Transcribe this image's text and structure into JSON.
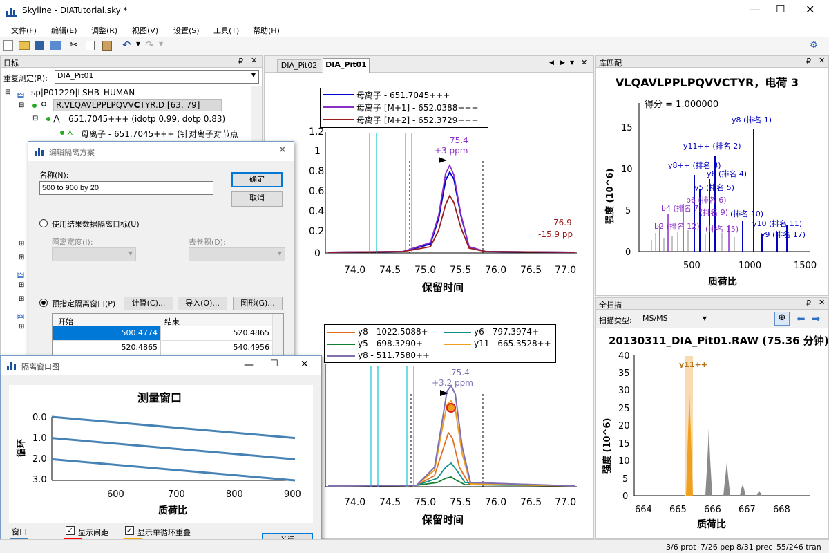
{
  "window": {
    "title": "Skyline - DIATutorial.sky *"
  },
  "menu": [
    "文件(F)",
    "编辑(E)",
    "调整(R)",
    "视图(V)",
    "设置(S)",
    "工具(T)",
    "帮助(H)"
  ],
  "targets": {
    "header": "目标",
    "replicate_label": "重复测定(R):",
    "replicate_value": "DIA_Pit01",
    "protein": "sp|P01229|LSHB_HUMAN",
    "peptide_pre": "R.VLQAVLPPLPQVV",
    "peptide_bold": "C",
    "peptide_post": "TYR.D [63, 79]",
    "precursor": "651.7045+++ (idotp 0.99, dotp 0.83)",
    "transition": "母离子 - 651.7045+++ (针对离子对节点"
  },
  "chrom": {
    "tabs": [
      "DIA_Pit02",
      "DIA_Pit01"
    ],
    "top": {
      "legend": [
        {
          "label": "母离子 - 651.7045+++",
          "color": "#0000d0"
        },
        {
          "label": "母离子 [M+1] - 652.0388+++",
          "color": "#8b2fc9"
        },
        {
          "label": "母离子 [M+2] - 652.3729+++",
          "color": "#9b1c1c"
        }
      ],
      "peak_rt": "75.4",
      "peak_ppm": "+3 ppm",
      "side_rt": "76.9",
      "side_ppm": "-15.9 pp",
      "yticks": [
        "1.2",
        "1",
        "0.8",
        "0.6",
        "0.4",
        "0.2",
        "0"
      ]
    },
    "bottom": {
      "legend": [
        {
          "label": "y8 - 1022.5088+",
          "color": "#e07020"
        },
        {
          "label": "y6 - 797.3974+",
          "color": "#10908a"
        },
        {
          "label": "y5 - 698.3290+",
          "color": "#108030"
        },
        {
          "label": "y11 - 665.3528++",
          "color": "#f0a020"
        },
        {
          "label": "y8 - 511.7580++",
          "color": "#8070b0"
        }
      ],
      "peak_rt": "75.4",
      "peak_ppm": "+3.2 ppm"
    },
    "xticks": [
      "74.0",
      "74.5",
      "75.0",
      "75.5",
      "76.0",
      "76.5",
      "77.0"
    ],
    "xlabel": "保留时间"
  },
  "library": {
    "header": "库匹配",
    "title": "VLQAVLPPLPQVVCTYR，电荷 3",
    "score": "得分 = 1.000000",
    "ylabel": "强度 (10^6)",
    "xlabel": "质荷比",
    "yticks": [
      "15",
      "10",
      "5",
      "0"
    ],
    "xticks": [
      "500",
      "1000",
      "1500"
    ],
    "labels": [
      "y8 (排名 1)",
      "y11++ (排名 2)",
      "y8++ (排名 3)",
      "y6 (排名 4)",
      "y5 (排名 5)",
      "b6 (排名 6)",
      "b4 (排名 7)",
      "(排名 9)",
      "(排名 10)",
      "y10 (排名 11)",
      "b2 (排名 12)",
      "y9 (排名 17)",
      "(排名 15)"
    ]
  },
  "fullscan": {
    "header": "全扫描",
    "scan_type_label": "扫描类型:",
    "scan_type_value": "MS/MS",
    "title": "20130311_DIA_Pit01.RAW (75.36 分钟)",
    "ion_label": "y11++",
    "ylabel": "强度 (10^6)",
    "xlabel": "质荷比",
    "yticks": [
      "40",
      "35",
      "30",
      "25",
      "20",
      "15",
      "10",
      "5",
      "0"
    ],
    "xticks": [
      "664",
      "665",
      "666",
      "667",
      "668"
    ]
  },
  "edit_dialog": {
    "title": "编辑隔离方案",
    "name_label": "名称(N):",
    "name_value": "500 to 900 by 20",
    "ok": "确定",
    "cancel": "取消",
    "radio1": "使用结果数据隔离目标(U)",
    "width_label": "隔离宽度(I):",
    "deconv_label": "去卷积(D):",
    "radio2": "预指定隔离窗口(P)",
    "calc": "计算(C)...",
    "import": "导入(O)...",
    "graph": "图形(G)...",
    "col_start": "开始",
    "col_end": "结束",
    "rows": [
      [
        "500.4774",
        "520.4865"
      ],
      [
        "520.4865",
        "540.4956"
      ]
    ]
  },
  "window_graph": {
    "title": "隔离窗口图",
    "chart_title": "测量窗口",
    "ylabel": "循环",
    "xlabel": "质荷比",
    "yticks": [
      "0.0",
      "1.0",
      "2.0",
      "3.0"
    ],
    "xticks": [
      "600",
      "700",
      "800",
      "900"
    ],
    "legend_window": "窗口",
    "show_gaps": "显示间距",
    "show_overlap": "显示单循环重叠",
    "close": "关闭"
  },
  "status": [
    "3/6 prot",
    "7/26 pep",
    "8/31 prec",
    "55/246 tran"
  ],
  "chart_data": [
    {
      "type": "line",
      "title": "",
      "x_range": [
        73.7,
        77.0
      ],
      "ylim": [
        0,
        1.2
      ],
      "xlabel": "保留时间",
      "series": [
        {
          "name": "母离子 - 651.7045+++"
        },
        {
          "name": "母离子 [M+1] - 652.0388+++"
        },
        {
          "name": "母离子 [M+2] - 652.3729+++"
        }
      ]
    },
    {
      "type": "line",
      "title": "测量窗口",
      "xlabel": "质荷比",
      "ylabel": "循环",
      "x_range": [
        500,
        900
      ],
      "ylim": [
        0,
        3
      ],
      "series": [
        {
          "x": [
            500,
            900
          ],
          "y": [
            0.0,
            1.0
          ]
        },
        {
          "x": [
            500,
            900
          ],
          "y": [
            1.0,
            2.0
          ]
        },
        {
          "x": [
            500,
            900
          ],
          "y": [
            2.0,
            3.0
          ]
        }
      ]
    }
  ]
}
